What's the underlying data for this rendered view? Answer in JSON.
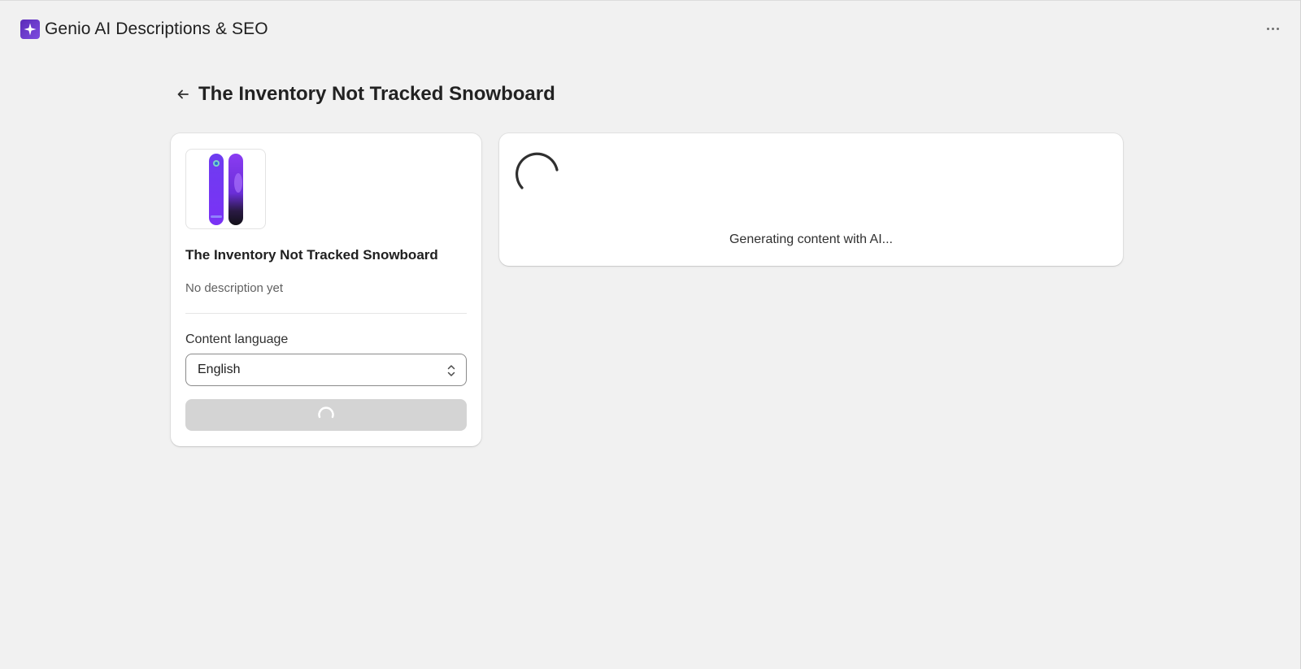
{
  "app": {
    "title": "Genio AI Descriptions & SEO",
    "logo_icon": "sparkle-icon",
    "brand_color": "#6a3bd1"
  },
  "header": {
    "more_icon": "more-horizontal-icon"
  },
  "page": {
    "title": "The Inventory Not Tracked Snowboard",
    "back_icon": "arrow-left-icon"
  },
  "product_card": {
    "image_icon": "snowboard-image",
    "name": "The Inventory Not Tracked Snowboard",
    "description": "No description yet",
    "language_label": "Content language",
    "language_value": "English",
    "language_options": [
      "English"
    ],
    "generate_button_state": "loading"
  },
  "content_card": {
    "status": "Generating content with AI..."
  },
  "colors": {
    "background": "#f1f1f1",
    "card": "#ffffff",
    "disabled_button": "#d4d4d4",
    "spinner": "#303030"
  }
}
